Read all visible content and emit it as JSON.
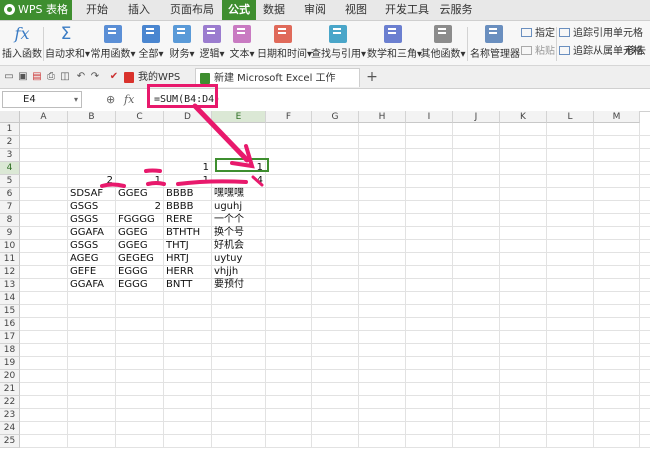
{
  "app": {
    "name": "WPS 表格"
  },
  "menu_tabs": [
    "开始",
    "插入",
    "页面布局",
    "公式",
    "数据",
    "审阅",
    "视图",
    "开发工具",
    "云服务"
  ],
  "active_tab": "公式",
  "ribbon": {
    "insert_function": "插入函数",
    "autosum": "自动求和",
    "common": "常用函数",
    "all": "全部",
    "finance": "财务",
    "logic": "逻辑",
    "text": "文本",
    "datetime": "日期和时间",
    "lookup": "查找与引用",
    "math": "数学和三角",
    "other": "其他函数",
    "name_manager": "名称管理器",
    "specify": "指定",
    "paste": "粘贴",
    "trace_precedents": "追踪引用单元格",
    "trace_dependents": "追踪从属单元格",
    "remove": "移去"
  },
  "doc_tabs": [
    {
      "label": "我的WPS"
    },
    {
      "label": "新建 Microsoft Excel 工作表.xlsx *"
    }
  ],
  "formula_bar": {
    "name_box": "E4",
    "fx": "fx",
    "formula": "=SUM(B4:D4)"
  },
  "columns": [
    "A",
    "B",
    "C",
    "D",
    "E",
    "F",
    "G",
    "H",
    "I",
    "J",
    "K",
    "L",
    "M"
  ],
  "rows": [
    "1",
    "2",
    "3",
    "4",
    "5",
    "6",
    "7",
    "8",
    "9",
    "10",
    "11",
    "12",
    "13",
    "14",
    "15",
    "16",
    "17",
    "18",
    "19",
    "20",
    "21",
    "22",
    "23",
    "24",
    "25"
  ],
  "cells": {
    "D4": "1",
    "E4": "1",
    "B5": "2",
    "C5": "1",
    "D5": "1",
    "E5": "4",
    "B6": "SDSAF",
    "C6": "GGEG",
    "D6": "BBBB",
    "E6": "嘿嘿嘿",
    "B7": "GSGS",
    "C7": "2",
    "D7": "BBBB",
    "E7": "uguhj",
    "B8": "GSGS",
    "C8": "FGGGG",
    "D8": "RERE",
    "E8": "一个个",
    "B9": "GGAFA",
    "C9": "GGEG",
    "D9": "BTHTH",
    "E9": "换个号",
    "B10": "GSGS",
    "C10": "GGEG",
    "D10": "THTJ",
    "E10": "好机会",
    "B11": "AGEG",
    "C11": "GEGEG",
    "D11": "HRTJ",
    "E11": "uytuy",
    "B12": "GEFE",
    "C12": "EGGG",
    "D12": "HERR",
    "E12": "vhjjh",
    "B13": "GGAFA",
    "C13": "EGGG",
    "D13": "BNTT",
    "E13": "要预付"
  },
  "colors": {
    "accent": "#3e8e2f",
    "annotation": "#e8196c"
  }
}
